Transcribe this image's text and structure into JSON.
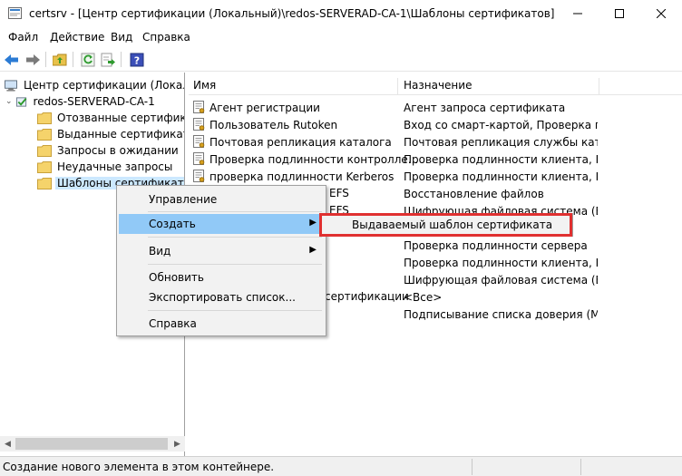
{
  "window": {
    "title": "certsrv - [Центр сертификации (Локальный)\\redos-SERVERAD-CA-1\\Шаблоны сертификатов]"
  },
  "menu": [
    "Файл",
    "Действие",
    "Вид",
    "Справка"
  ],
  "tree": {
    "root": "Центр сертификации (Локальный)",
    "ca": "redos-SERVERAD-CA-1",
    "folders": [
      "Отозванные сертификаты",
      "Выданные сертификаты",
      "Запросы в ожидании",
      "Неудачные запросы",
      "Шаблоны сертификатов"
    ]
  },
  "list": {
    "columns": [
      "Имя",
      "Назначение"
    ],
    "rows": [
      {
        "name": "Агент регистрации",
        "purpose": "Агент запроса сертификата"
      },
      {
        "name": "Пользователь Rutoken",
        "purpose": "Вход со смарт-картой, Проверка под..."
      },
      {
        "name": "Почтовая репликация каталога",
        "purpose": "Почтовая репликация службы катало..."
      },
      {
        "name": "Проверка подлинности контролле...",
        "purpose": "Проверка подлинности клиента, Про..."
      },
      {
        "name": "проверка подлинности Kerberos",
        "purpose": "Проверка подлинности клиента, Про..."
      },
      {
        "name": "EFS",
        "purpose": "Восстановление файлов"
      },
      {
        "name": "EFS",
        "purpose": "Шифрующая файловая система (EFS)"
      },
      {
        "name": "",
        "purpose": "Про..."
      },
      {
        "name": "",
        "purpose": "Проверка подлинности сервера"
      },
      {
        "name": "",
        "purpose": "Проверка подлинности клиента, Про..."
      },
      {
        "name": "",
        "purpose": "Шифрующая файловая система (EFS)..."
      },
      {
        "name": "сертификации",
        "purpose": "<Все>"
      },
      {
        "name": "",
        "purpose": "Подписывание списка доверия (Micr..."
      }
    ]
  },
  "context_menu": {
    "manage": "Управление",
    "create": "Создать",
    "view": "Вид",
    "refresh": "Обновить",
    "export": "Экспортировать список...",
    "help": "Справка"
  },
  "submenu": {
    "item": "Выдаваемый шаблон сертификата"
  },
  "status": "Создание нового элемента в этом контейнере.",
  "colors": {
    "highlight": "#91c9f7",
    "selection": "#cce8ff",
    "redbox": "#e03030"
  }
}
